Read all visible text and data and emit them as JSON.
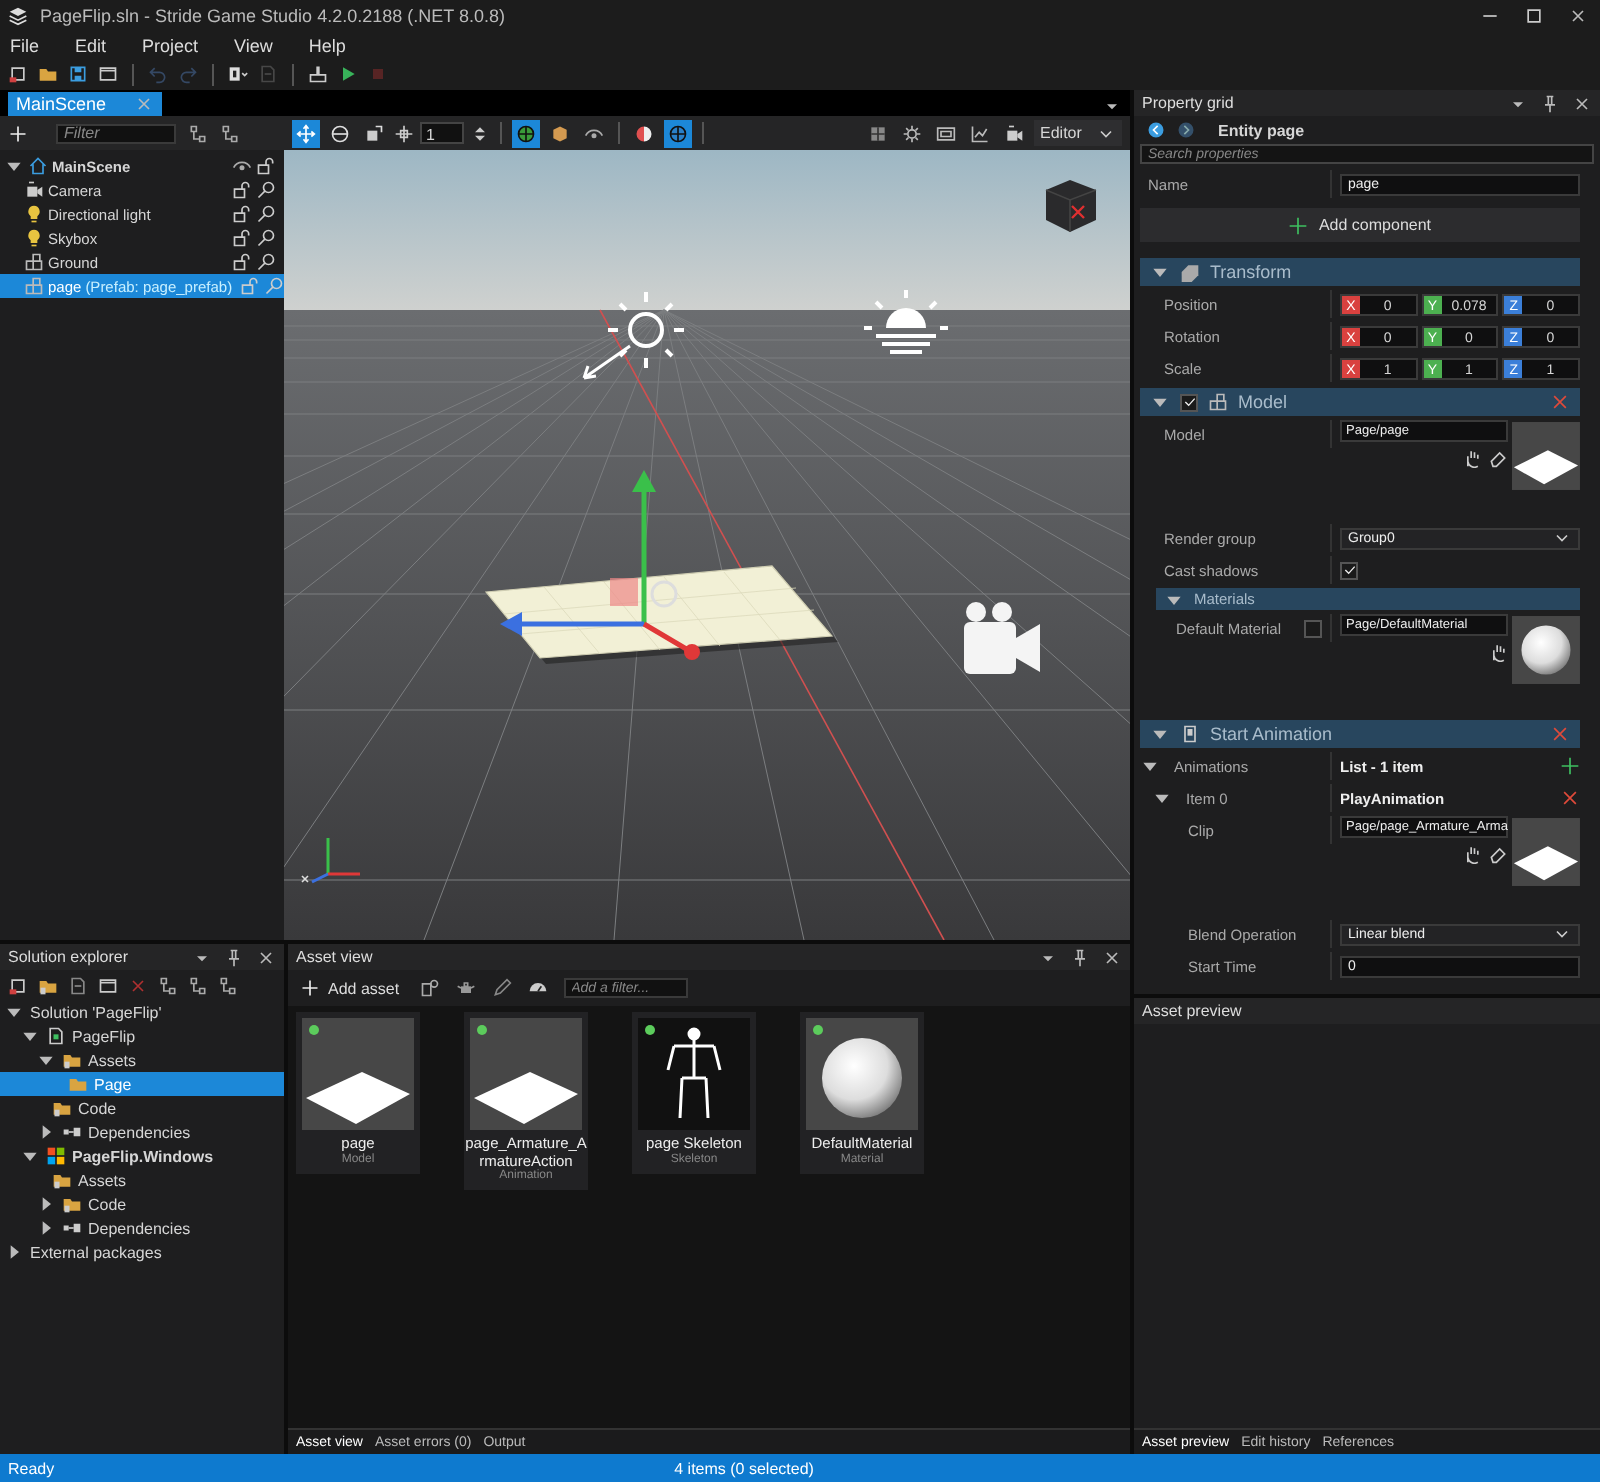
{
  "window": {
    "title": "PageFlip.sln - Stride Game Studio 4.2.0.2188 (.NET 8.0.8)"
  },
  "menu": [
    "File",
    "Edit",
    "Project",
    "View",
    "Help"
  ],
  "toolbar": [
    {
      "kind": "new-scene",
      "disabled": false
    },
    {
      "kind": "open",
      "disabled": false
    },
    {
      "kind": "save",
      "disabled": false
    },
    {
      "kind": "window",
      "disabled": false
    },
    {
      "kind": "undo",
      "disabled": true
    },
    {
      "kind": "redo",
      "disabled": true
    },
    {
      "kind": "vs",
      "disabled": false
    },
    {
      "kind": "package",
      "disabled": true
    },
    {
      "kind": "build",
      "disabled": false
    },
    {
      "kind": "play",
      "disabled": false
    },
    {
      "kind": "stop",
      "disabled": true
    }
  ],
  "document_tabs": [
    {
      "label": "MainScene",
      "selected": true
    }
  ],
  "scene_tree": {
    "filter_placeholder": "Filter",
    "items": [
      {
        "label": "MainScene",
        "kind": "scene",
        "expanded": true,
        "selected": false,
        "children": [
          {
            "label": "Camera",
            "kind": "camera",
            "selected": false
          },
          {
            "label": "Directional light",
            "kind": "light",
            "selected": false
          },
          {
            "label": "Skybox",
            "kind": "light",
            "selected": false
          },
          {
            "label": "Ground",
            "kind": "entity",
            "selected": false
          },
          {
            "label": "page",
            "prefab": "(Prefab: page_prefab)",
            "kind": "entity",
            "selected": true
          }
        ]
      }
    ]
  },
  "viewport_toolbar": {
    "tools": [
      {
        "kind": "translate",
        "selected": true
      },
      {
        "kind": "rotate",
        "selected": false
      },
      {
        "kind": "scale",
        "selected": false
      }
    ],
    "snap_value": "1",
    "toggles": [
      {
        "kind": "globe",
        "selected": true
      },
      {
        "kind": "cube",
        "selected": false
      },
      {
        "kind": "eye",
        "selected": false
      }
    ],
    "render": [
      {
        "kind": "shading",
        "selected": false
      },
      {
        "kind": "globe-blue",
        "selected": true
      }
    ],
    "mode": "Editor"
  },
  "solution_explorer": {
    "title": "Solution explorer",
    "items": [
      {
        "label": "Solution 'PageFlip'",
        "expanded": true,
        "selected": false,
        "children": [
          {
            "label": "PageFlip",
            "kind": "project",
            "startup": false,
            "expanded": true,
            "selected": false,
            "children": [
              {
                "label": "Assets",
                "kind": "assets",
                "expanded": true,
                "selected": false,
                "children": [
                  {
                    "label": "Page",
                    "kind": "folder",
                    "selected": true
                  }
                ]
              },
              {
                "label": "Code",
                "kind": "assets",
                "selected": false
              },
              {
                "label": "Dependencies",
                "kind": "deps",
                "expanded": false,
                "selected": false
              }
            ]
          },
          {
            "label": "PageFlip.Windows",
            "kind": "windows",
            "startup": true,
            "expanded": true,
            "selected": false,
            "children": [
              {
                "label": "Assets",
                "kind": "assets",
                "selected": false
              },
              {
                "label": "Code",
                "kind": "assets",
                "expanded": false,
                "selected": false
              },
              {
                "label": "Dependencies",
                "kind": "deps",
                "expanded": false,
                "selected": false
              }
            ]
          }
        ]
      },
      {
        "label": "External packages",
        "expanded": false,
        "selected": false
      }
    ]
  },
  "asset_view": {
    "title": "Asset view",
    "add_label": "Add asset",
    "filter_placeholder": "Add a filter...",
    "assets": [
      {
        "name": "page",
        "type": "Model",
        "kind": "plane"
      },
      {
        "name": "page_Armature_ArmatureAction",
        "type": "Animation",
        "kind": "plane"
      },
      {
        "name": "page Skeleton",
        "type": "Skeleton",
        "kind": "skeleton"
      },
      {
        "name": "DefaultMaterial",
        "type": "Material",
        "kind": "sphere"
      }
    ],
    "tabs": [
      {
        "label": "Asset view",
        "selected": true
      },
      {
        "label": "Asset errors (0)",
        "selected": false
      },
      {
        "label": "Output",
        "selected": false
      }
    ]
  },
  "property_grid": {
    "title": "Property grid",
    "entity": "Entity page",
    "search_placeholder": "Search properties",
    "name_label": "Name",
    "name_value": "page",
    "add_component": "Add component",
    "sections": [
      {
        "title": "Transform",
        "kind": "transform",
        "expanded": true,
        "rows": [
          {
            "kind": "vector",
            "label": "Position",
            "values": [
              {
                "axis": "X",
                "value": "0",
                "color": "#d9413f"
              },
              {
                "axis": "Y",
                "value": "0.078",
                "color": "#4cb050"
              },
              {
                "axis": "Z",
                "value": "0",
                "color": "#3b7fd9"
              }
            ]
          },
          {
            "kind": "vector",
            "label": "Rotation",
            "values": [
              {
                "axis": "X",
                "value": "0",
                "color": "#d9413f"
              },
              {
                "axis": "Y",
                "value": "0",
                "color": "#4cb050"
              },
              {
                "axis": "Z",
                "value": "0",
                "color": "#3b7fd9"
              }
            ]
          },
          {
            "kind": "vector",
            "label": "Scale",
            "values": [
              {
                "axis": "X",
                "value": "1",
                "color": "#d9413f"
              },
              {
                "axis": "Y",
                "value": "1",
                "color": "#4cb050"
              },
              {
                "axis": "Z",
                "value": "1",
                "color": "#3b7fd9"
              }
            ]
          }
        ]
      },
      {
        "title": "Model",
        "kind": "model",
        "expanded": true,
        "enabled": true,
        "removable": true,
        "rows": [
          {
            "kind": "asset",
            "label": "Model",
            "value": "Page/page",
            "thumbnail": {
              "kind": "plane"
            },
            "clearable": true
          },
          {
            "kind": "dropdown",
            "label": "Render group",
            "value": "Group0"
          },
          {
            "kind": "checkbox",
            "label": "Cast shadows",
            "checked": true
          },
          {
            "kind": "group",
            "title": "Materials",
            "expanded": true,
            "rows": [
              {
                "kind": "asset",
                "label": "Default Material",
                "checked": false,
                "value": "Page/DefaultMaterial",
                "thumbnail": {
                  "kind": "sphere"
                },
                "clearable": false
              }
            ]
          }
        ]
      },
      {
        "title": "Start Animation",
        "kind": "animation",
        "expanded": true,
        "removable": true,
        "rows": [
          {
            "kind": "list",
            "label": "Animations",
            "value": "List - 1 item",
            "expanded": true,
            "rows": [
              {
                "kind": "item",
                "label": "Item 0",
                "value": "PlayAnimation",
                "expanded": true,
                "rows": [
                  {
                    "kind": "asset",
                    "label": "Clip",
                    "value": "Page/page_Armature_Arma",
                    "thumbnail": {
                      "kind": "plane"
                    },
                    "clearable": true
                  },
                  {
                    "kind": "dropdown",
                    "label": "Blend Operation",
                    "value": "Linear blend"
                  },
                  {
                    "kind": "text",
                    "label": "Start Time",
                    "value": "0"
                  }
                ]
              }
            ]
          }
        ]
      }
    ]
  },
  "asset_preview": {
    "title": "Asset preview",
    "tabs": [
      {
        "label": "Asset preview",
        "selected": true
      },
      {
        "label": "Edit history",
        "selected": false
      },
      {
        "label": "References",
        "selected": false
      }
    ]
  },
  "status_bar": {
    "left": "Ready",
    "right": "4 items (0 selected)"
  }
}
